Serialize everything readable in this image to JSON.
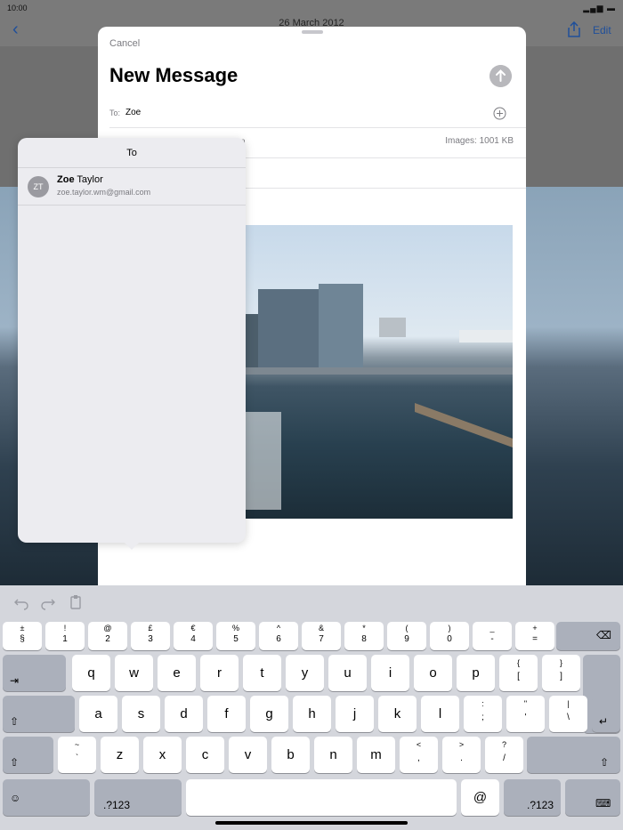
{
  "status": {
    "time": "10:00"
  },
  "photos_bar": {
    "date": "26 March 2012",
    "edit_label": "Edit"
  },
  "compose": {
    "cancel_label": "Cancel",
    "title": "New Message",
    "to_label": "To:",
    "to_value": "Zoe",
    "cc_partial": "n",
    "images_label": "Images:",
    "images_size": "1001 KB"
  },
  "suggestions": {
    "title": "To",
    "contacts": [
      {
        "initials": "ZT",
        "first": "Zoe",
        "last": " Taylor",
        "email": "zoe.taylor.wm@gmail.com"
      }
    ]
  },
  "keyboard": {
    "symbol_row": [
      {
        "top": "±",
        "bot": "§"
      },
      {
        "top": "!",
        "bot": "1"
      },
      {
        "top": "@",
        "bot": "2"
      },
      {
        "top": "£",
        "bot": "3"
      },
      {
        "top": "€",
        "bot": "4"
      },
      {
        "top": "%",
        "bot": "5"
      },
      {
        "top": "^",
        "bot": "6"
      },
      {
        "top": "&",
        "bot": "7"
      },
      {
        "top": "*",
        "bot": "8"
      },
      {
        "top": "(",
        "bot": "9"
      },
      {
        "top": ")",
        "bot": "0"
      },
      {
        "top": "_",
        "bot": "-"
      },
      {
        "top": "+",
        "bot": "="
      }
    ],
    "row1": [
      "q",
      "w",
      "e",
      "r",
      "t",
      "y",
      "u",
      "i",
      "o",
      "p"
    ],
    "row1_extra": [
      {
        "top": "{",
        "bot": "["
      },
      {
        "top": "}",
        "bot": "]"
      }
    ],
    "row2": [
      "a",
      "s",
      "d",
      "f",
      "g",
      "h",
      "j",
      "k",
      "l"
    ],
    "row2_extra": [
      {
        "top": ":",
        "bot": ";"
      },
      {
        "top": "\"",
        "bot": "'"
      },
      {
        "top": "|",
        "bot": "\\"
      }
    ],
    "row3": [
      "z",
      "x",
      "c",
      "v",
      "b",
      "n",
      "m"
    ],
    "row3_extra_left": {
      "top": "~",
      "bot": "`"
    },
    "row3_extra": [
      {
        "top": "<",
        "bot": ","
      },
      {
        "top": ">",
        "bot": "."
      },
      {
        "top": "?",
        "bot": "/"
      }
    ],
    "numbers_label": ".?123",
    "at_label": "@"
  }
}
